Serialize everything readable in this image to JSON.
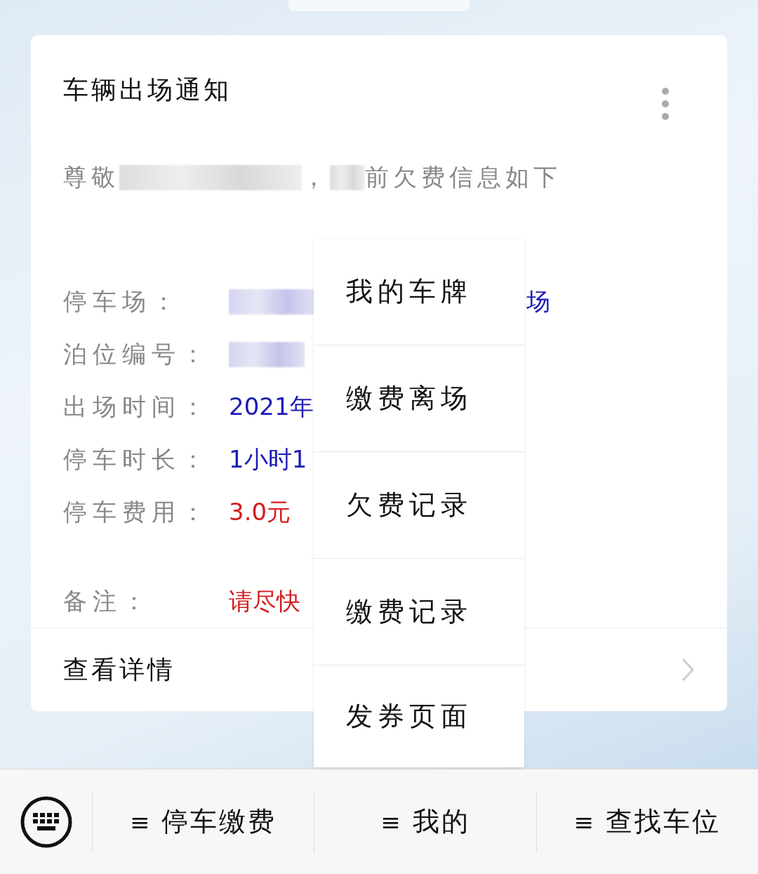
{
  "card": {
    "title": "车辆出场通知",
    "greeting": [
      {
        "kind": "text",
        "text": "尊敬"
      },
      {
        "kind": "blur"
      },
      {
        "kind": "text",
        "text": "，"
      },
      {
        "kind": "blur"
      },
      {
        "kind": "text",
        "text": "前欠费信息如下"
      }
    ],
    "fields": [
      {
        "label": "停车场：",
        "color": "#1c1cb4",
        "value": [
          {
            "kind": "blur"
          },
          {
            "kind": "text",
            "text": "场"
          }
        ]
      },
      {
        "label": "泊位编号：",
        "value": [
          {
            "kind": "blur"
          }
        ]
      },
      {
        "label": "出场时间：",
        "color": "#1c1cb4",
        "value": [
          {
            "kind": "text",
            "text": "2021年"
          }
        ]
      },
      {
        "label": "停车时长：",
        "color": "#1c1cb4",
        "value": [
          {
            "kind": "text",
            "text": "1小时1"
          }
        ]
      },
      {
        "label": "停车费用：",
        "color": "#d41c1c",
        "value": [
          {
            "kind": "text",
            "text": "3.0元"
          }
        ]
      }
    ],
    "note": {
      "label": "备注：",
      "color": "#d41c1c",
      "value": [
        {
          "kind": "text",
          "text": "请尽快"
        }
      ]
    },
    "details_link": "查看详情"
  },
  "popup_menu": {
    "items": [
      {
        "label": "我的车牌"
      },
      {
        "label": "缴费离场"
      },
      {
        "label": "欠费记录"
      },
      {
        "label": "缴费记录"
      },
      {
        "label": "发券页面"
      }
    ]
  },
  "bottom_menu": [
    {
      "icon": "≡",
      "label": "停车缴费"
    },
    {
      "icon": "≡",
      "label": "我的"
    },
    {
      "icon": "≡",
      "label": "查找车位"
    }
  ]
}
